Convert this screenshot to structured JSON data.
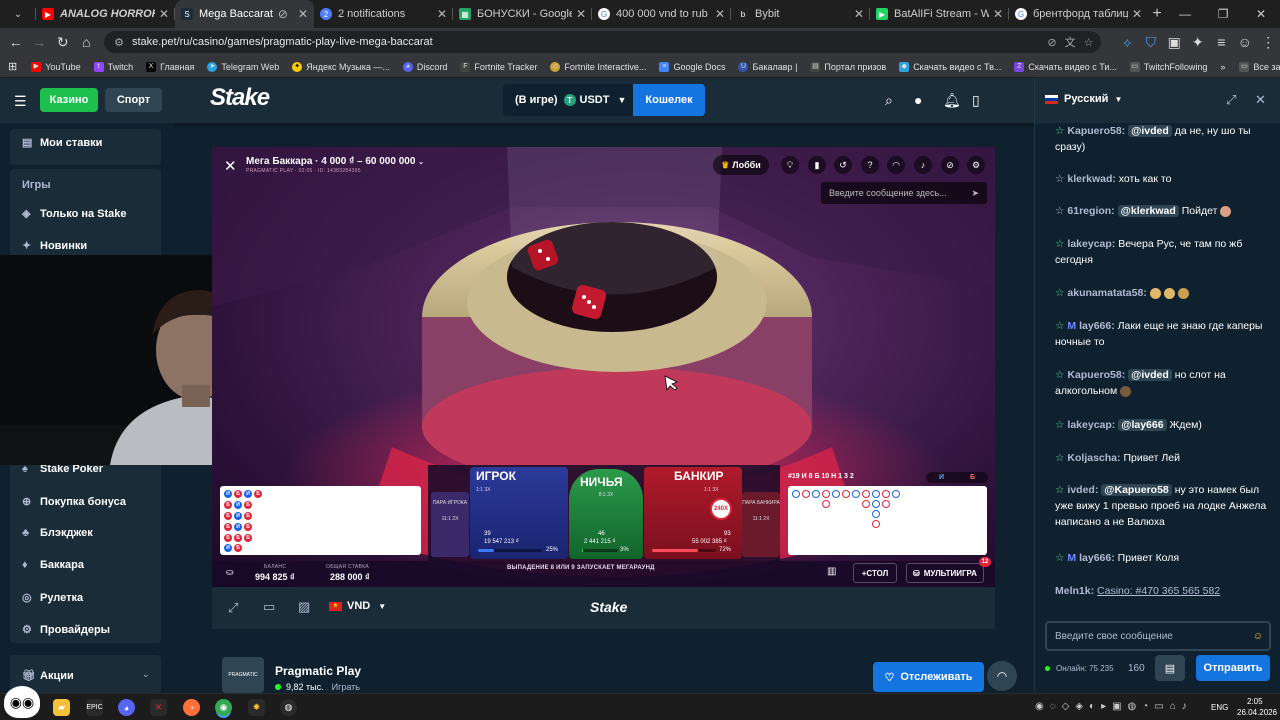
{
  "browser": {
    "tabs": [
      {
        "label": "ANALOG HORROR FUNK",
        "color": "#ff0000",
        "icon": "youtube-icon"
      },
      {
        "label": "Mega Baccarat Live C",
        "color": "#1a2c38",
        "icon": "stake-icon"
      },
      {
        "label": "2 notifications",
        "color": "#4d7cff",
        "icon": "notification-icon"
      },
      {
        "label": "БОНУСКИ - Google Табл",
        "color": "#21a464",
        "icon": "sheets-icon"
      },
      {
        "label": "400 000 vnd to rub - Пои",
        "color": "#ffffff",
        "icon": "google-icon"
      },
      {
        "label": "Bybit",
        "color": "#222222",
        "icon": "bybit-icon"
      },
      {
        "label": "BatAlIFi Stream - Watch L",
        "color": "#1ed760",
        "icon": "stream-icon"
      },
      {
        "label": "брентфорд таблица - По",
        "color": "#ffffff",
        "icon": "google-icon"
      }
    ],
    "url": "stake.pet/ru/casino/games/pragmatic-play-live-mega-baccarat",
    "bookmarks": [
      {
        "label": "YouTube",
        "color": "#ff0000"
      },
      {
        "label": "Twitch",
        "color": "#9146ff"
      },
      {
        "label": "Главная",
        "color": "#000000"
      },
      {
        "label": "Telegram Web",
        "color": "#2aa3de"
      },
      {
        "label": "Яндекс Музыка —...",
        "color": "#ffcc00"
      },
      {
        "label": "Discord",
        "color": "#5865f2"
      },
      {
        "label": "Fortnite Tracker",
        "color": "#444444"
      },
      {
        "label": "Fortnite Interactive...",
        "color": "#c9a23a"
      },
      {
        "label": "Google Docs",
        "color": "#4285f4"
      },
      {
        "label": "Бакалавр |",
        "color": "#3355aa"
      },
      {
        "label": "Портал призов",
        "color": "#444444"
      },
      {
        "label": "Скачать видео с Тв...",
        "color": "#2aa3de"
      },
      {
        "label": "Скачать видео с Ти...",
        "color": "#7a44e0"
      },
      {
        "label": "TwitchFollowing",
        "color": "#555555"
      }
    ],
    "all_bookmarks": "Все закладки"
  },
  "header": {
    "casino": "Казино",
    "sport": "Спорт",
    "logo": "Stake",
    "wallet_status": "(В игре)",
    "currency": "USDT",
    "wallet_button": "Кошелек"
  },
  "sidebar": {
    "my_bets": "Мои ставки",
    "games_label": "Игры",
    "items_top": [
      "Только на Stake",
      "Новинки"
    ],
    "items": [
      "Stake Poker",
      "Покупка бонуса",
      "Блэкджек",
      "Баккара",
      "Рулетка",
      "Провайдеры"
    ],
    "promotions": "Акции"
  },
  "game": {
    "title": "Мега Баккара · 4 000 ₫ – 60 000 000",
    "subtitle": "PRAGMATIC PLAY · 02:05 · ID: 14383284395",
    "lobby": "Лобби",
    "chat_placeholder": "Введите сообщение здесь...",
    "player": "ИГРОК",
    "tie": "НИЧЬЯ",
    "banker": "БАНКИР",
    "player_pair": "ПАРА ИГРОКА",
    "banker_pair": "ПАРА БАНКИРА",
    "player_mult": "1:1  3X",
    "tie_mult": "8:1  3X",
    "banker_mult": "1:1  3X",
    "pair_mult": "11:1  2X",
    "banker_badge": "240X",
    "player_count": "39",
    "player_amount": "19 547 213 ₫",
    "player_pct": "25%",
    "tie_count": "46",
    "tie_amount": "2 441 215 ₫",
    "tie_pct": "3%",
    "banker_count": "93",
    "banker_amount": "55 002 385 ₫",
    "banker_pct": "72%",
    "balance_label": "БАЛАНС",
    "balance": "994 825 ₫",
    "total_bet_label": "ОБЩАЯ СТАВКА",
    "total_bet": "288 000 ₫",
    "mega_text": "ВЫПАДЕНИЕ 8 ИЛИ 9 ЗАПУСКАЕТ МЕГАРАУНД",
    "table_button": "+СТОЛ",
    "multi_button": "МУЛЬТИИГРА",
    "multi_badge": "12",
    "stats": "#19  И 8  Б 10  Н 1  3  2",
    "percent_player_fill": 25,
    "percent_tie_fill": 3,
    "percent_banker_fill": 72
  },
  "footer": {
    "currency": "VND",
    "logo": "Stake"
  },
  "provider": {
    "name": "Pragmatic Play",
    "count": "9,82 тыс.",
    "play": "Играть",
    "follow": "Отслеживать"
  },
  "chat": {
    "language": "Русский",
    "placeholder": "Введите свое сообщение",
    "online": "Онлайн: 75 235",
    "count": "160",
    "send": "Отправить",
    "messages": [
      {
        "user": "Kapuero58:",
        "mention": "@ivded",
        "text": "да не, ну шо ты сразу)"
      },
      {
        "user": "klerkwad:",
        "mention": "",
        "text": "хоть как то"
      },
      {
        "user": "61region:",
        "mention": "@klerkwad",
        "text": "Пойдет"
      },
      {
        "user": "lakeycap:",
        "mention": "",
        "text": "Вечера Рус, че там по жб сегодня"
      },
      {
        "user": "akunamatata58:",
        "mention": "",
        "text": ""
      },
      {
        "user": "lay666:",
        "mention": "",
        "text": "Лаки   еще не знаю где каперы ночные то"
      },
      {
        "user": "Kapuero58:",
        "mention": "@ivded",
        "text": "но слот на алкогольном"
      },
      {
        "user": "lakeycap:",
        "mention": "@lay666",
        "text": "Ждем)"
      },
      {
        "user": "Koljascha:",
        "mention": "",
        "text": "Привет Лей"
      },
      {
        "user": "ivded:",
        "mention": "@Kapuero58",
        "text": "ну это намек был   уже вижу 1 превью проеб на лодке Анжела написано а не Валюха"
      },
      {
        "user": "lay666:",
        "mention": "",
        "text": "Привет Коля"
      },
      {
        "user": "Meln1k:",
        "mention": "",
        "text": "Casino: #470 365 565 582"
      }
    ]
  },
  "taskbar": {
    "lang": "ENG",
    "time": "2:05",
    "date": "26.04.2026"
  }
}
